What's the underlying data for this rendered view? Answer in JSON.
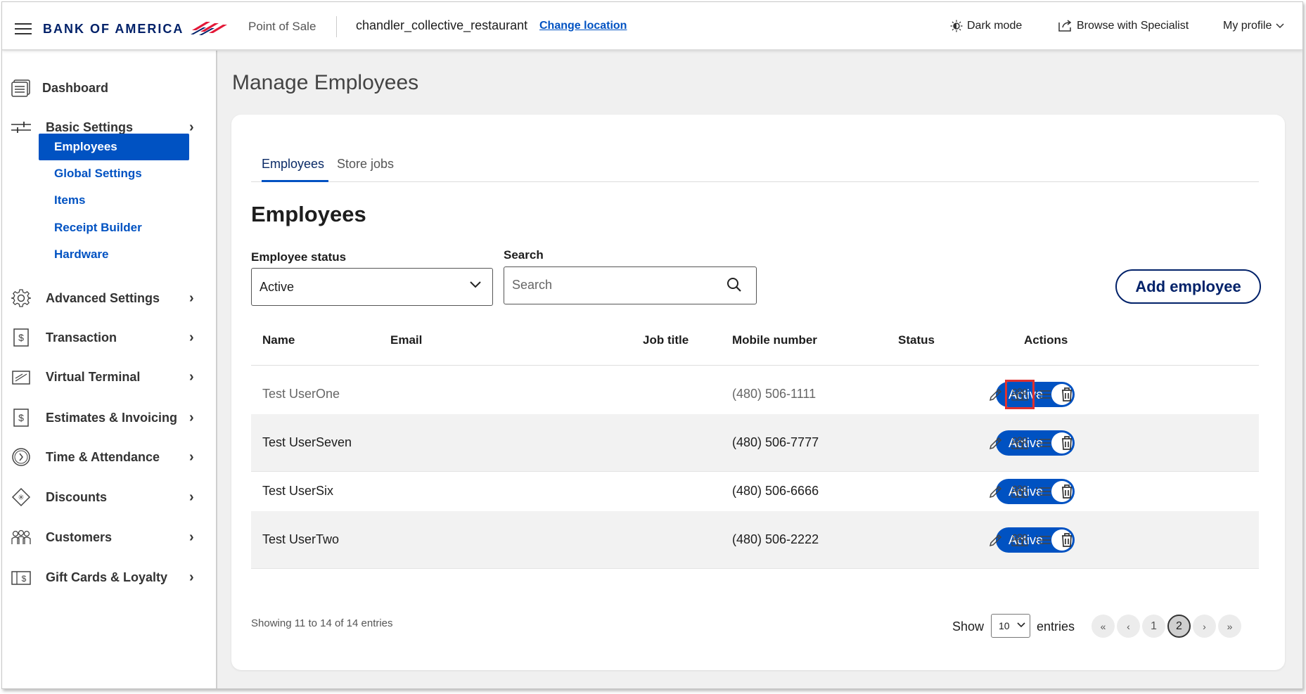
{
  "header": {
    "brand": "BANK OF AMERICA",
    "app": "Point of Sale",
    "location": "chandler_collective_restaurant",
    "change_location": "Change location",
    "dark_mode": "Dark mode",
    "browse_specialist": "Browse with Specialist",
    "my_profile": "My profile"
  },
  "sidebar": {
    "dashboard": "Dashboard",
    "basic_settings": "Basic Settings",
    "sub_items": [
      "Employees",
      "Global Settings",
      "Items",
      "Receipt Builder",
      "Hardware"
    ],
    "advanced_settings": "Advanced Settings",
    "transaction": "Transaction",
    "virtual_terminal": "Virtual Terminal",
    "estimates_invoicing": "Estimates & Invoicing",
    "time_attendance": "Time & Attendance",
    "discounts": "Discounts",
    "customers": "Customers",
    "gift_cards": "Gift Cards & Loyalty"
  },
  "main": {
    "page_title": "Manage Employees",
    "tabs": [
      "Employees",
      "Store jobs"
    ],
    "section_title": "Employees",
    "status_label": "Employee status",
    "status_value": "Active",
    "search_label": "Search",
    "search_placeholder": "Search",
    "add_button": "Add employee"
  },
  "table": {
    "headers": [
      "Name",
      "Email",
      "Job title",
      "Mobile number",
      "Status",
      "Actions"
    ],
    "rows": [
      {
        "name": "Test UserOne",
        "email": "",
        "job_title": "",
        "mobile": "(480) 506-1111",
        "status": "Active"
      },
      {
        "name": "Test UserSeven",
        "email": "",
        "job_title": "",
        "mobile": "(480) 506-7777",
        "status": "Active"
      },
      {
        "name": "Test UserSix",
        "email": "",
        "job_title": "",
        "mobile": "(480) 506-6666",
        "status": "Active"
      },
      {
        "name": "Test UserTwo",
        "email": "",
        "job_title": "",
        "mobile": "(480) 506-2222",
        "status": "Active"
      }
    ],
    "action_icons": [
      "pencil-icon",
      "group-icon",
      "list-icon",
      "trash-icon"
    ]
  },
  "footer": {
    "showing": "Showing 11 to 14 of 14 entries",
    "show": "Show",
    "entries_value": "10",
    "entries": "entries",
    "pagination": {
      "first": "«",
      "prev": "‹",
      "pages": [
        "1",
        "2"
      ],
      "current": "2",
      "next": "›",
      "last": "»"
    }
  },
  "colors": {
    "primary": "#0052c2",
    "brand_navy": "#012169",
    "brand_red": "#e31837",
    "highlight": "#e0312f"
  }
}
